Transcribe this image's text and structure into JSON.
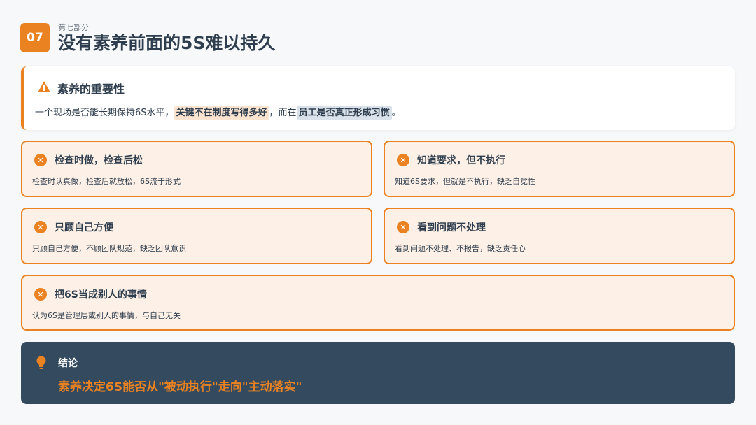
{
  "header": {
    "number": "07",
    "kicker": "第七部分",
    "title": "没有素养前面的5S难以持久"
  },
  "intro": {
    "title": "素养的重要性",
    "text_before": "一个现场是否能长期保持6S水平，",
    "highlight_1": "关键不在制度写得多好",
    "text_middle": "，而在",
    "highlight_2": "员工是否真正形成习惯",
    "text_after": "。"
  },
  "cards": [
    {
      "title": "检查时做，检查后松",
      "desc": "检查时认真做，检查后就放松，6S流于形式"
    },
    {
      "title": "知道要求，但不执行",
      "desc": "知道6S要求，但就是不执行，缺乏自觉性"
    },
    {
      "title": "只顾自己方便",
      "desc": "只顾自己方便，不顾团队规范，缺乏团队意识"
    },
    {
      "title": "看到问题不处理",
      "desc": "看到问题不处理、不报告，缺乏责任心"
    },
    {
      "title": "把6S当成别人的事情",
      "desc": "认为6S是管理层或别人的事情，与自己无关"
    }
  ],
  "conclusion": {
    "title": "结论",
    "text": "素养决定6S能否从\"被动执行\"走向\"主动落实\""
  },
  "colors": {
    "accent": "#ea8222",
    "dark": "#344a5e",
    "card_bg": "#fdf0e6"
  },
  "icons": {
    "intro": "warning-triangle-icon",
    "card": "x-circle-icon",
    "conclusion": "lightbulb-icon"
  }
}
